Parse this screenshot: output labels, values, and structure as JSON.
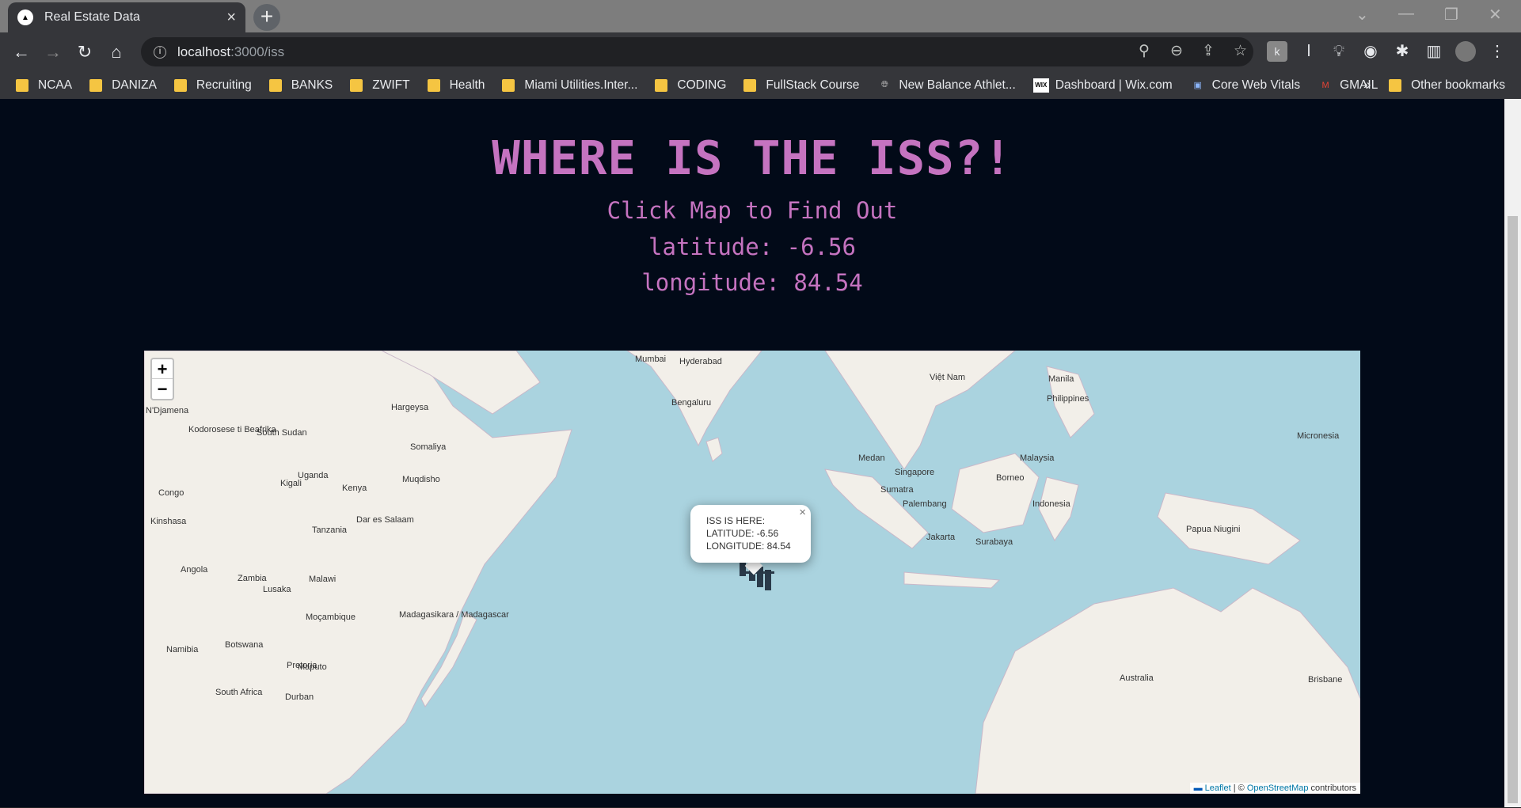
{
  "browser": {
    "tab_title": "Real Estate Data",
    "url_host": "localhost",
    "url_path": ":3000/iss"
  },
  "bookmarks": [
    {
      "label": "NCAA",
      "type": "folder"
    },
    {
      "label": "DANIZA",
      "type": "folder"
    },
    {
      "label": "Recruiting",
      "type": "folder"
    },
    {
      "label": "BANKS",
      "type": "folder"
    },
    {
      "label": "ZWIFT",
      "type": "folder"
    },
    {
      "label": "Health",
      "type": "folder"
    },
    {
      "label": "Miami Utilities.Inter...",
      "type": "folder"
    },
    {
      "label": "CODING",
      "type": "folder"
    },
    {
      "label": "FullStack Course",
      "type": "folder"
    },
    {
      "label": "New Balance Athlet...",
      "type": "globe"
    },
    {
      "label": "Dashboard | Wix.com",
      "type": "wix"
    },
    {
      "label": "Core Web Vitals",
      "type": "site"
    },
    {
      "label": "GMAIL",
      "type": "gmail"
    }
  ],
  "bookmarks_overflow": "»",
  "other_bookmarks": "Other bookmarks",
  "page": {
    "heading": "WHERE IS THE ISS?!",
    "subtitle": "Click Map to Find Out",
    "latitude_text": "latitude: -6.56",
    "longitude_text": "longitude: 84.54"
  },
  "map": {
    "zoom_in": "+",
    "zoom_out": "−",
    "popup": {
      "line1": "ISS IS HERE:",
      "line2": "LATITUDE: -6.56",
      "line3": "LONGITUDE: 84.54",
      "close": "×"
    },
    "attribution": {
      "leaflet": "Leaflet",
      "sep": " | © ",
      "osm": "OpenStreetMap",
      "suffix": " contributors"
    },
    "labels": [
      "Mumbai",
      "Hyderabad",
      "Bengaluru",
      "Manila",
      "Philippines",
      "Việt Nam",
      "Medan",
      "Singapore",
      "Sumatra",
      "Palembang",
      "Jakarta",
      "Surabaya",
      "Malaysia",
      "Borneo",
      "Indonesia",
      "Papua Niugini",
      "Micronesia",
      "Australia",
      "Brisbane",
      "Kenya",
      "Somaliya",
      "Muqdisho",
      "Uganda",
      "Tanzania",
      "Dar es Salaam",
      "Angola",
      "Zambia",
      "Malawi",
      "Lusaka",
      "Moçambique",
      "Namibia",
      "Botswana",
      "Pretoria",
      "Maputo",
      "South Africa",
      "Durban",
      "Madagasikara / Madagascar",
      "South Sudan",
      "Kigali",
      "Congo",
      "Kinshasa",
      "Hargeysa",
      "N'Djamena",
      "Kodorosese ti Beafrika"
    ],
    "iss_lat": -6.56,
    "iss_lon": 84.54
  }
}
